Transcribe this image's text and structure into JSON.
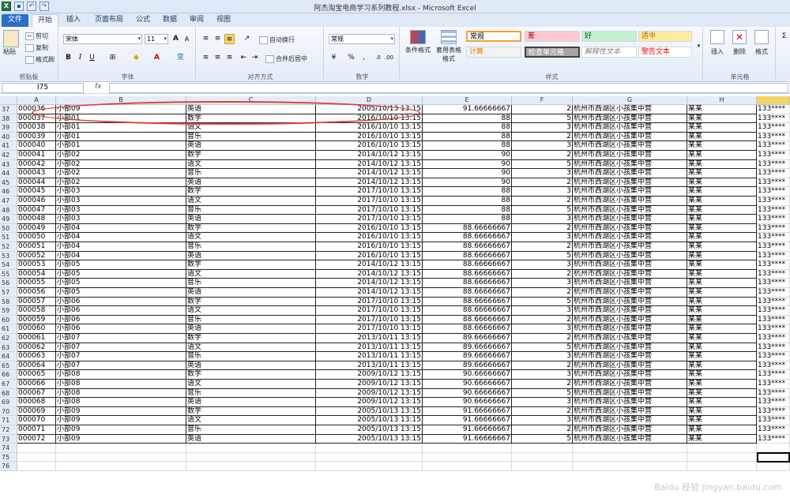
{
  "window": {
    "title": "阿杰淘宝电商学习系列教程.xlsx - Microsoft Excel"
  },
  "tabs": [
    {
      "label": "文件"
    },
    {
      "label": "开始"
    },
    {
      "label": "插入"
    },
    {
      "label": "页面布局"
    },
    {
      "label": "公式"
    },
    {
      "label": "数据"
    },
    {
      "label": "审阅"
    },
    {
      "label": "视图"
    }
  ],
  "ribbon": {
    "clipboard": {
      "paste": "粘贴",
      "cut": "剪切",
      "copy": "复制",
      "format_painter": "格式刷",
      "group": "剪贴板"
    },
    "font": {
      "name": "宋体",
      "size": "11",
      "group": "字体",
      "bold": "B",
      "italic": "I",
      "underline": "U",
      "grow": "A",
      "shrink": "A",
      "wen": "变"
    },
    "alignment": {
      "wrap": "自动换行",
      "merge": "合并后居中",
      "group": "对齐方式"
    },
    "number": {
      "format": "常规",
      "group": "数字",
      "percent": "%",
      "comma": ","
    },
    "styles": {
      "cond_format": "条件格式",
      "table_format": "套用表格格式",
      "group": "样式",
      "cells": [
        {
          "label": "常规",
          "bg": "#ffffff",
          "fg": "#000000"
        },
        {
          "label": "差",
          "bg": "#ffc7ce",
          "fg": "#9c0006"
        },
        {
          "label": "好",
          "bg": "#c6efce",
          "fg": "#006100"
        },
        {
          "label": "适中",
          "bg": "#ffeb9c",
          "fg": "#9c6500"
        },
        {
          "label": "计算",
          "bg": "#f2f2f2",
          "fg": "#fa7d00"
        },
        {
          "label": "检查单元格",
          "bg": "#a5a5a5",
          "fg": "#ffffff"
        },
        {
          "label": "解释性文本",
          "bg": "#ffffff",
          "fg": "#7f7f7f"
        },
        {
          "label": "警告文本",
          "bg": "#ffffff",
          "fg": "#ff0000"
        }
      ]
    },
    "cells_group": {
      "insert": "插入",
      "delete": "删除",
      "format": "格式",
      "group": "单元格"
    }
  },
  "formula_bar": {
    "name_box": "I75",
    "fx": "fx",
    "value": ""
  },
  "columns": [
    "A",
    "B",
    "C",
    "D",
    "E",
    "F",
    "G",
    "H"
  ],
  "rows": [
    {
      "n": "37",
      "a": "000036",
      "b": "小部09",
      "c": "英语",
      "d": "2005/10/13 13:15",
      "e": "91.66666667",
      "f": "2",
      "g": "杭州市西湖区小孩集中营",
      "h": "某某",
      "i": "133****"
    },
    {
      "n": "38",
      "a": "000037",
      "b": "小部01",
      "c": "数学",
      "d": "2016/10/10 13:15",
      "e": "88",
      "f": "5",
      "g": "杭州市西湖区小孩集中营",
      "h": "某某",
      "i": "133****"
    },
    {
      "n": "39",
      "a": "000038",
      "b": "小部01",
      "c": "语文",
      "d": "2016/10/10 13:15",
      "e": "88",
      "f": "3",
      "g": "杭州市西湖区小孩集中营",
      "h": "某某",
      "i": "133****"
    },
    {
      "n": "40",
      "a": "000039",
      "b": "小部01",
      "c": "音乐",
      "d": "2016/10/10 13:15",
      "e": "88",
      "f": "2",
      "g": "杭州市西湖区小孩集中营",
      "h": "某某",
      "i": "133****"
    },
    {
      "n": "41",
      "a": "000040",
      "b": "小部01",
      "c": "英语",
      "d": "2016/10/10 13:15",
      "e": "88",
      "f": "3",
      "g": "杭州市西湖区小孩集中营",
      "h": "某某",
      "i": "133****"
    },
    {
      "n": "42",
      "a": "000041",
      "b": "小部02",
      "c": "数学",
      "d": "2014/10/12 13:15",
      "e": "90",
      "f": "2",
      "g": "杭州市西湖区小孩集中营",
      "h": "某某",
      "i": "133****"
    },
    {
      "n": "43",
      "a": "000042",
      "b": "小部02",
      "c": "语文",
      "d": "2014/10/12 13:15",
      "e": "90",
      "f": "5",
      "g": "杭州市西湖区小孩集中营",
      "h": "某某",
      "i": "133****"
    },
    {
      "n": "44",
      "a": "000043",
      "b": "小部02",
      "c": "音乐",
      "d": "2014/10/12 13:15",
      "e": "90",
      "f": "3",
      "g": "杭州市西湖区小孩集中营",
      "h": "某某",
      "i": "133****"
    },
    {
      "n": "45",
      "a": "000044",
      "b": "小部02",
      "c": "英语",
      "d": "2014/10/12 13:15",
      "e": "90",
      "f": "2",
      "g": "杭州市西湖区小孩集中营",
      "h": "某某",
      "i": "133****"
    },
    {
      "n": "46",
      "a": "000045",
      "b": "小部03",
      "c": "数学",
      "d": "2017/10/10 13:15",
      "e": "88",
      "f": "3",
      "g": "杭州市西湖区小孩集中营",
      "h": "某某",
      "i": "133****"
    },
    {
      "n": "47",
      "a": "000046",
      "b": "小部03",
      "c": "语文",
      "d": "2017/10/10 13:15",
      "e": "88",
      "f": "2",
      "g": "杭州市西湖区小孩集中营",
      "h": "某某",
      "i": "133****"
    },
    {
      "n": "48",
      "a": "000047",
      "b": "小部03",
      "c": "音乐",
      "d": "2017/10/10 13:15",
      "e": "88",
      "f": "5",
      "g": "杭州市西湖区小孩集中营",
      "h": "某某",
      "i": "133****"
    },
    {
      "n": "49",
      "a": "000048",
      "b": "小部03",
      "c": "英语",
      "d": "2017/10/10 13:15",
      "e": "88",
      "f": "3",
      "g": "杭州市西湖区小孩集中营",
      "h": "某某",
      "i": "133****"
    },
    {
      "n": "50",
      "a": "000049",
      "b": "小部04",
      "c": "数学",
      "d": "2016/10/10 13:15",
      "e": "88.66666667",
      "f": "2",
      "g": "杭州市西湖区小孩集中营",
      "h": "某某",
      "i": "133****"
    },
    {
      "n": "51",
      "a": "000050",
      "b": "小部04",
      "c": "语文",
      "d": "2016/10/10 13:15",
      "e": "88.66666667",
      "f": "3",
      "g": "杭州市西湖区小孩集中营",
      "h": "某某",
      "i": "133****"
    },
    {
      "n": "52",
      "a": "000051",
      "b": "小部04",
      "c": "音乐",
      "d": "2016/10/10 13:15",
      "e": "88.66666667",
      "f": "2",
      "g": "杭州市西湖区小孩集中营",
      "h": "某某",
      "i": "133****"
    },
    {
      "n": "53",
      "a": "000052",
      "b": "小部04",
      "c": "英语",
      "d": "2016/10/10 13:15",
      "e": "88.66666667",
      "f": "5",
      "g": "杭州市西湖区小孩集中营",
      "h": "某某",
      "i": "133****"
    },
    {
      "n": "54",
      "a": "000053",
      "b": "小部05",
      "c": "数学",
      "d": "2014/10/12 13:15",
      "e": "88.66666667",
      "f": "3",
      "g": "杭州市西湖区小孩集中营",
      "h": "某某",
      "i": "133****"
    },
    {
      "n": "55",
      "a": "000054",
      "b": "小部05",
      "c": "语文",
      "d": "2014/10/12 13:15",
      "e": "88.66666667",
      "f": "2",
      "g": "杭州市西湖区小孩集中营",
      "h": "某某",
      "i": "133****"
    },
    {
      "n": "56",
      "a": "000055",
      "b": "小部05",
      "c": "音乐",
      "d": "2014/10/12 13:15",
      "e": "88.66666667",
      "f": "3",
      "g": "杭州市西湖区小孩集中营",
      "h": "某某",
      "i": "133****"
    },
    {
      "n": "57",
      "a": "000056",
      "b": "小部05",
      "c": "英语",
      "d": "2014/10/12 13:15",
      "e": "88.66666667",
      "f": "2",
      "g": "杭州市西湖区小孩集中营",
      "h": "某某",
      "i": "133****"
    },
    {
      "n": "58",
      "a": "000057",
      "b": "小部06",
      "c": "数学",
      "d": "2017/10/10 13:15",
      "e": "88.66666667",
      "f": "5",
      "g": "杭州市西湖区小孩集中营",
      "h": "某某",
      "i": "133****"
    },
    {
      "n": "59",
      "a": "000058",
      "b": "小部06",
      "c": "语文",
      "d": "2017/10/10 13:15",
      "e": "88.66666667",
      "f": "3",
      "g": "杭州市西湖区小孩集中营",
      "h": "某某",
      "i": "133****"
    },
    {
      "n": "60",
      "a": "000059",
      "b": "小部06",
      "c": "音乐",
      "d": "2017/10/10 13:15",
      "e": "88.66666667",
      "f": "2",
      "g": "杭州市西湖区小孩集中营",
      "h": "某某",
      "i": "133****"
    },
    {
      "n": "61",
      "a": "000060",
      "b": "小部06",
      "c": "英语",
      "d": "2017/10/10 13:15",
      "e": "88.66666667",
      "f": "3",
      "g": "杭州市西湖区小孩集中营",
      "h": "某某",
      "i": "133****"
    },
    {
      "n": "62",
      "a": "000061",
      "b": "小部07",
      "c": "数学",
      "d": "2013/10/11 13:15",
      "e": "89.66666667",
      "f": "2",
      "g": "杭州市西湖区小孩集中营",
      "h": "某某",
      "i": "133****"
    },
    {
      "n": "63",
      "a": "000062",
      "b": "小部07",
      "c": "语文",
      "d": "2013/10/11 13:15",
      "e": "89.66666667",
      "f": "5",
      "g": "杭州市西湖区小孩集中营",
      "h": "某某",
      "i": "133****"
    },
    {
      "n": "64",
      "a": "000063",
      "b": "小部07",
      "c": "音乐",
      "d": "2013/10/11 13:15",
      "e": "89.66666667",
      "f": "3",
      "g": "杭州市西湖区小孩集中营",
      "h": "某某",
      "i": "133****"
    },
    {
      "n": "65",
      "a": "000064",
      "b": "小部07",
      "c": "英语",
      "d": "2013/10/11 13:15",
      "e": "89.66666667",
      "f": "2",
      "g": "杭州市西湖区小孩集中营",
      "h": "某某",
      "i": "133****"
    },
    {
      "n": "66",
      "a": "000065",
      "b": "小部08",
      "c": "数学",
      "d": "2009/10/12 13:15",
      "e": "90.66666667",
      "f": "3",
      "g": "杭州市西湖区小孩集中营",
      "h": "某某",
      "i": "133****"
    },
    {
      "n": "67",
      "a": "000066",
      "b": "小部08",
      "c": "语文",
      "d": "2009/10/12 13:15",
      "e": "90.66666667",
      "f": "2",
      "g": "杭州市西湖区小孩集中营",
      "h": "某某",
      "i": "133****"
    },
    {
      "n": "68",
      "a": "000067",
      "b": "小部08",
      "c": "音乐",
      "d": "2009/10/12 13:15",
      "e": "90.66666667",
      "f": "5",
      "g": "杭州市西湖区小孩集中营",
      "h": "某某",
      "i": "133****"
    },
    {
      "n": "69",
      "a": "000068",
      "b": "小部08",
      "c": "英语",
      "d": "2009/10/12 13:15",
      "e": "90.66666667",
      "f": "3",
      "g": "杭州市西湖区小孩集中营",
      "h": "某某",
      "i": "133****"
    },
    {
      "n": "70",
      "a": "000069",
      "b": "小部09",
      "c": "数学",
      "d": "2005/10/13 13:15",
      "e": "91.66666667",
      "f": "2",
      "g": "杭州市西湖区小孩集中营",
      "h": "某某",
      "i": "133****"
    },
    {
      "n": "71",
      "a": "000070",
      "b": "小部09",
      "c": "语文",
      "d": "2005/10/13 13:15",
      "e": "91.66666667",
      "f": "3",
      "g": "杭州市西湖区小孩集中营",
      "h": "某某",
      "i": "133****"
    },
    {
      "n": "72",
      "a": "000071",
      "b": "小部09",
      "c": "音乐",
      "d": "2005/10/13 13:15",
      "e": "91.66666667",
      "f": "2",
      "g": "杭州市西湖区小孩集中营",
      "h": "某某",
      "i": "133****"
    },
    {
      "n": "73",
      "a": "000072",
      "b": "小部09",
      "c": "英语",
      "d": "2005/10/13 13:15",
      "e": "91.66666667",
      "f": "5",
      "g": "杭州市西湖区小孩集中营",
      "h": "某某",
      "i": "133****"
    }
  ],
  "empty_rows": [
    "74",
    "75",
    "76"
  ],
  "watermark": "Baidu 经验 jingyan.baidu.com"
}
